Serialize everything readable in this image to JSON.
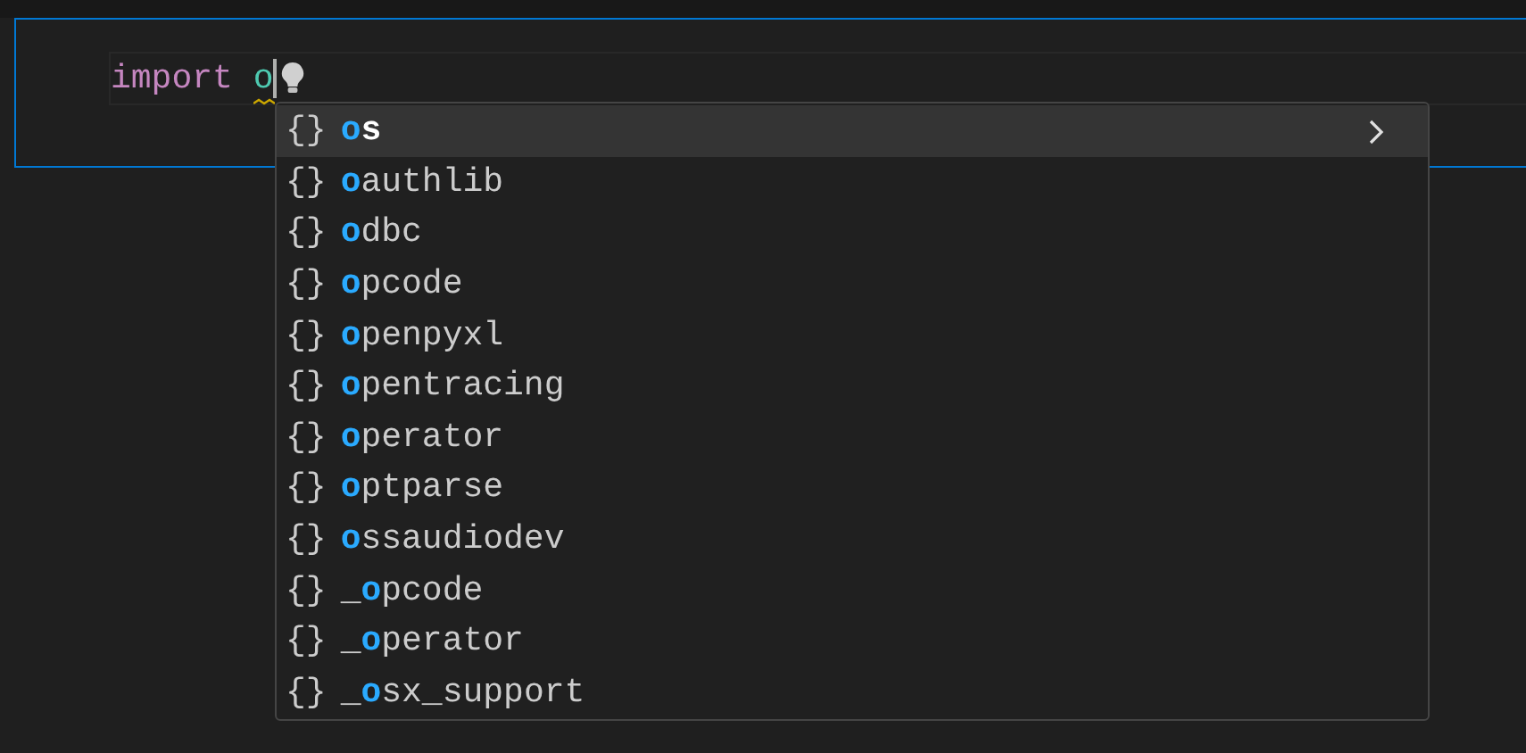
{
  "editor": {
    "line": [
      {
        "kind": "keyword",
        "text": "import"
      },
      {
        "kind": "module",
        "text": "o"
      }
    ],
    "squiggle": true,
    "lightbulb": true
  },
  "suggestions": [
    {
      "icon": "{}",
      "match": "o",
      "rest": "s",
      "selected": true,
      "has_details": true
    },
    {
      "icon": "{}",
      "match": "o",
      "rest": "authlib",
      "selected": false,
      "has_details": false
    },
    {
      "icon": "{}",
      "match": "o",
      "rest": "dbc",
      "selected": false,
      "has_details": false
    },
    {
      "icon": "{}",
      "match": "o",
      "rest": "pcode",
      "selected": false,
      "has_details": false
    },
    {
      "icon": "{}",
      "match": "o",
      "rest": "penpyxl",
      "selected": false,
      "has_details": false
    },
    {
      "icon": "{}",
      "match": "o",
      "rest": "pentracing",
      "selected": false,
      "has_details": false
    },
    {
      "icon": "{}",
      "match": "o",
      "rest": "perator",
      "selected": false,
      "has_details": false
    },
    {
      "icon": "{}",
      "match": "o",
      "rest": "ptparse",
      "selected": false,
      "has_details": false
    },
    {
      "icon": "{}",
      "match": "o",
      "rest": "ssaudiodev",
      "selected": false,
      "has_details": false
    },
    {
      "icon": "{}",
      "prefix": "_",
      "match": "o",
      "rest": "pcode",
      "selected": false,
      "has_details": false
    },
    {
      "icon": "{}",
      "prefix": "_",
      "match": "o",
      "rest": "perator",
      "selected": false,
      "has_details": false
    },
    {
      "icon": "{}",
      "prefix": "_",
      "match": "o",
      "rest": "sx_support",
      "selected": false,
      "has_details": false
    }
  ]
}
